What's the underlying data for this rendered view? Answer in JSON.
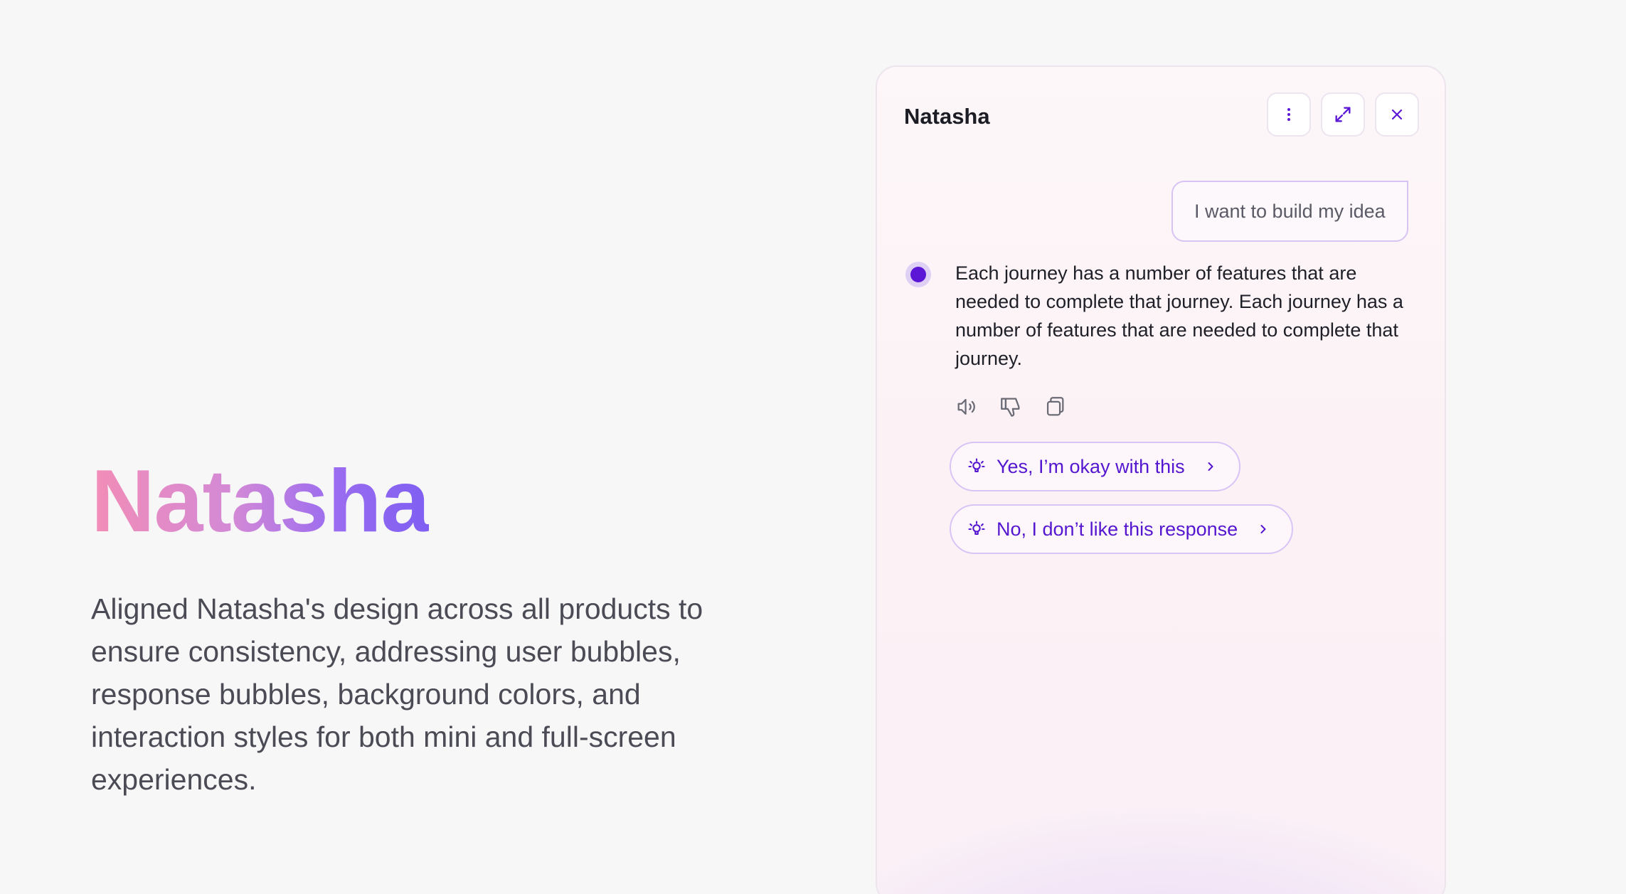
{
  "hero": {
    "title": "Natasha",
    "description": "Aligned Natasha's design across all products to ensure consistency, addressing user bubbles, response bubbles, background colors, and interaction styles for both mini and full-screen experiences."
  },
  "chat": {
    "title": "Natasha",
    "header_icons": [
      "more-vertical-icon",
      "expand-icon",
      "close-icon"
    ],
    "user_message": "I want to build my idea",
    "bot_message": "Each journey has a number of features that are needed to complete that journey. Each journey has a number of features that are needed to complete that journey.",
    "response_actions": [
      "speaker-icon",
      "thumbs-down-icon",
      "copy-icon"
    ],
    "suggestions": [
      {
        "label": "Yes, I’m okay with this",
        "icon": "lightbulb-icon"
      },
      {
        "label": "No, I don’t like this response",
        "icon": "lightbulb-icon"
      }
    ]
  },
  "colors": {
    "accent": "#5b16d6",
    "chip_text": "#5516d0",
    "chip_border": "#d9c4f6",
    "title_gradient": [
      "#f28db6",
      "#d389d6",
      "#9a6cf0",
      "#7f5ff2"
    ],
    "page_background": "#f7f7f8"
  }
}
